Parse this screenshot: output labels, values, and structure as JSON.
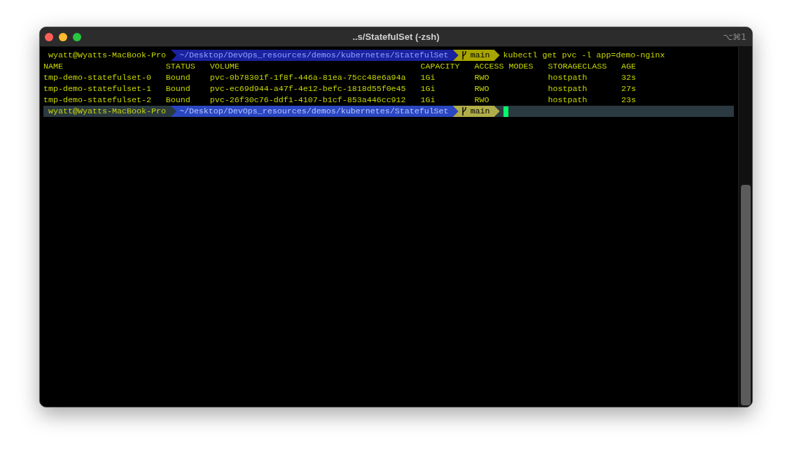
{
  "window": {
    "title": "..s/StatefulSet (-zsh)",
    "shortcut": "⌥⌘1"
  },
  "terminal": {
    "blocks": [
      {
        "prompt": {
          "user": "wyatt@Wyatts-MacBook-Pro",
          "path": "~/Desktop/DevOps_resources/demos/kubernetes/StatefulSet",
          "branch": "main",
          "command": "kubectl get pvc -l app=demo-nginx",
          "active": false
        },
        "table": {
          "columns": [
            "NAME",
            "STATUS",
            "VOLUME",
            "CAPACITY",
            "ACCESS MODES",
            "STORAGECLASS",
            "AGE"
          ],
          "rows": [
            [
              "tmp-demo-statefulset-0",
              "Bound",
              "pvc-0b78301f-1f8f-446a-81ea-75cc48e6a94a",
              "1Gi",
              "RWO",
              "hostpath",
              "32s"
            ],
            [
              "tmp-demo-statefulset-1",
              "Bound",
              "pvc-ec69d944-a47f-4e12-befc-1818d55f0e45",
              "1Gi",
              "RWO",
              "hostpath",
              "27s"
            ],
            [
              "tmp-demo-statefulset-2",
              "Bound",
              "pvc-26f30c76-ddf1-4107-b1cf-853a446cc912",
              "1Gi",
              "RWO",
              "hostpath",
              "23s"
            ]
          ]
        }
      },
      {
        "prompt": {
          "user": "wyatt@Wyatts-MacBook-Pro",
          "path": "~/Desktop/DevOps_resources/demos/kubernetes/StatefulSet",
          "branch": "main",
          "active": true
        }
      }
    ]
  }
}
